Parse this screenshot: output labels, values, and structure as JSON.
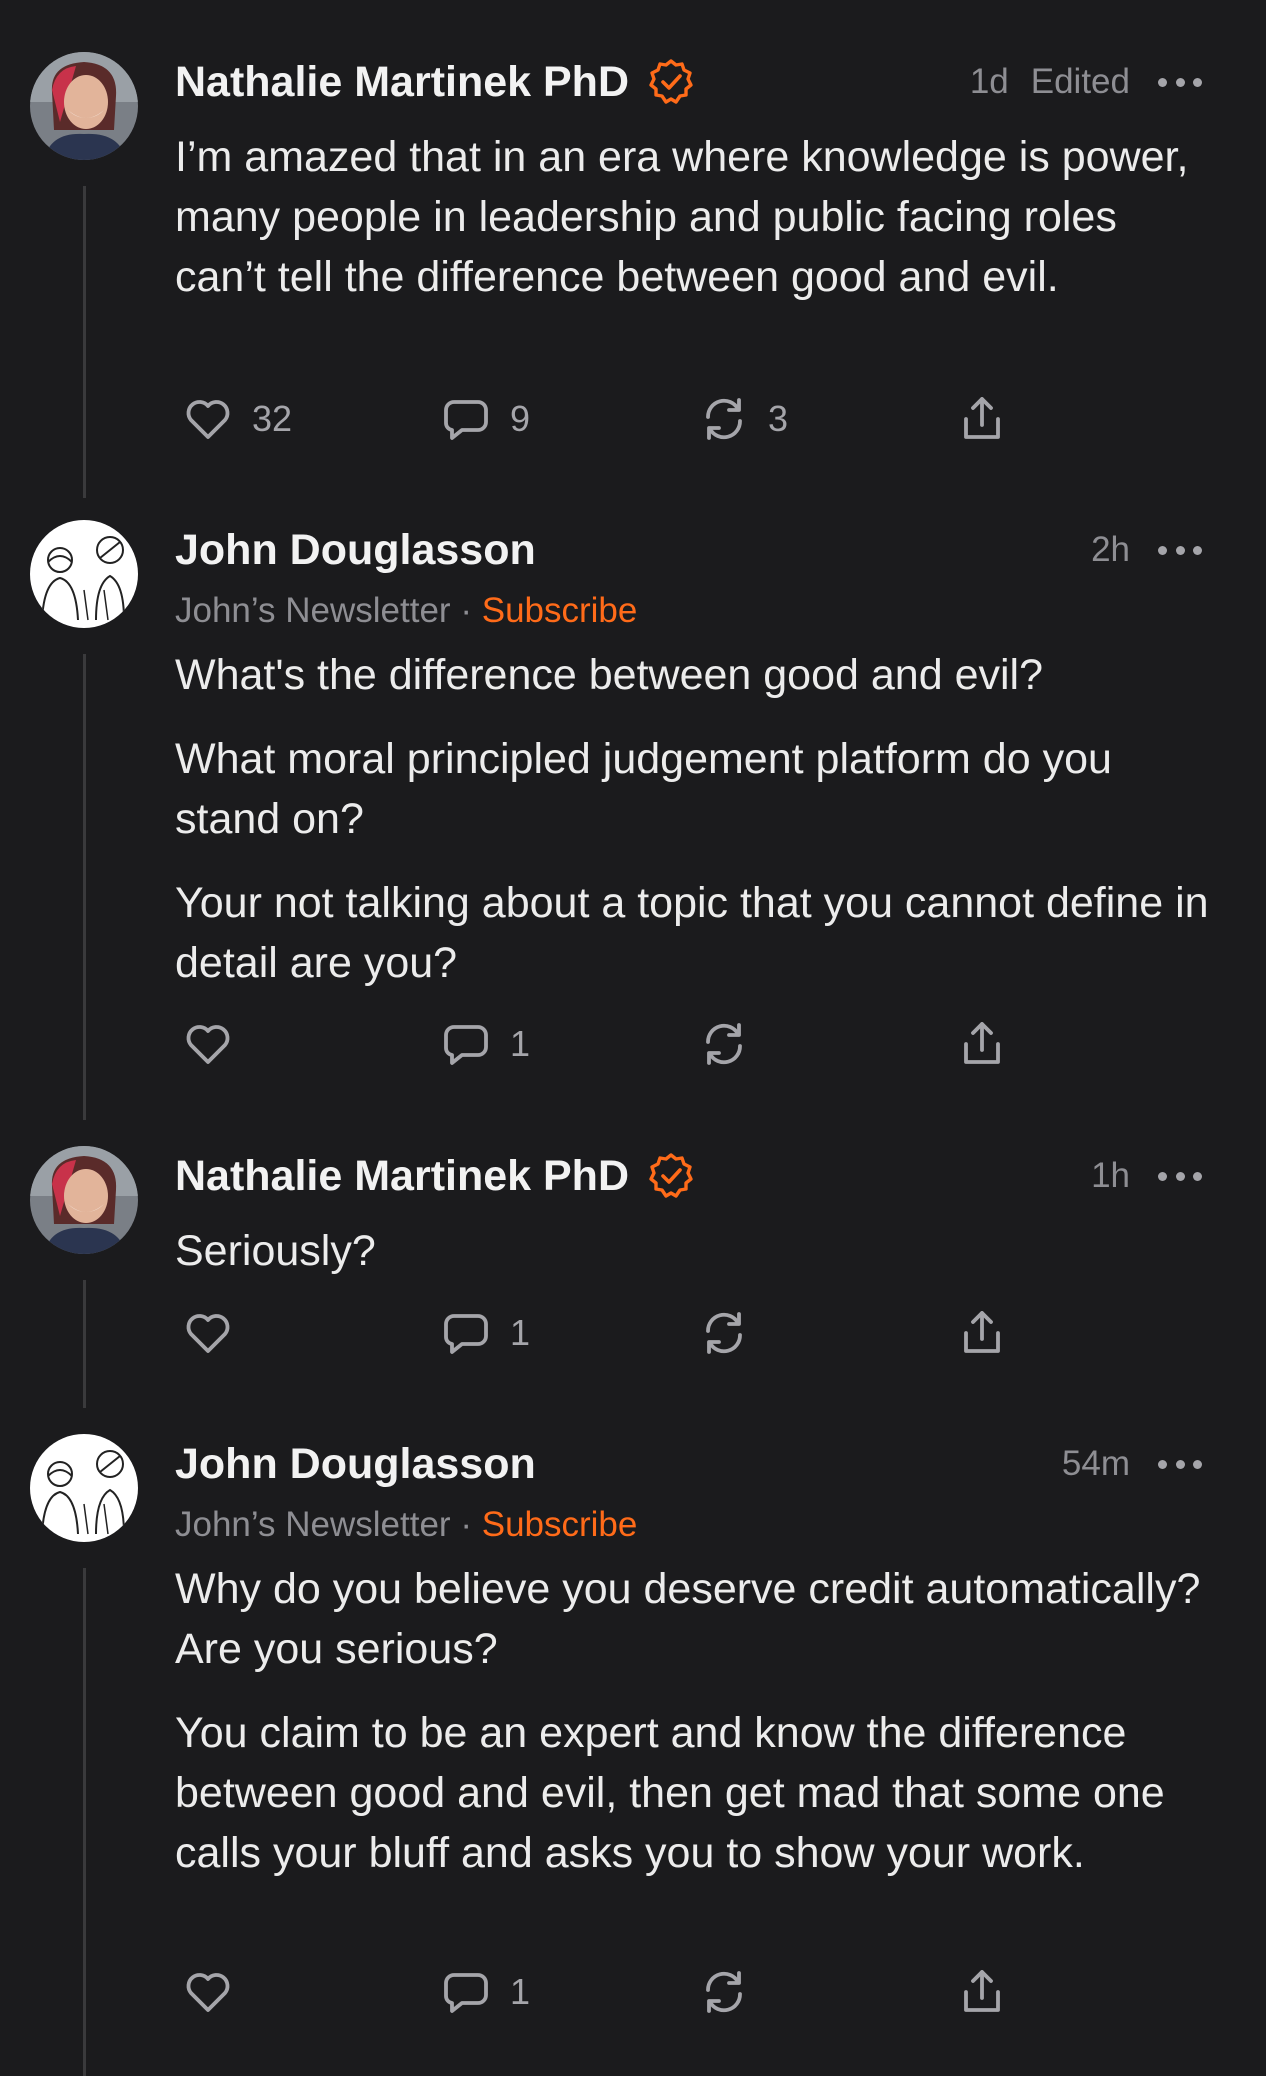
{
  "comments": [
    {
      "author": "Nathalie Martinek PhD",
      "verified": true,
      "time": "1d",
      "edited": "Edited",
      "body": [
        "I’m amazed that in an era where knowledge is power, many people in leadership and public facing roles can’t tell the difference between good and evil."
      ],
      "likes": "32",
      "replies": "9",
      "restacks": "3"
    },
    {
      "author": "John Douglasson",
      "verified": false,
      "time": "2h",
      "publication": "John’s Newsletter",
      "separator": "·",
      "subscribe": "Subscribe",
      "body": [
        "What's the difference between good and evil?",
        "What moral principled judgement platform do you stand on?",
        "Your not talking about a topic that you cannot define in detail are you?"
      ],
      "likes": "",
      "replies": "1",
      "restacks": ""
    },
    {
      "author": "Nathalie Martinek PhD",
      "verified": true,
      "time": "1h",
      "body": [
        "Seriously?"
      ],
      "likes": "",
      "replies": "1",
      "restacks": ""
    },
    {
      "author": "John Douglasson",
      "verified": false,
      "time": "54m",
      "publication": "John’s Newsletter",
      "separator": "·",
      "subscribe": "Subscribe",
      "body": [
        "Why do you believe you deserve credit automatically? Are you serious?",
        "You claim to be an expert and know the difference between good and evil, then get mad that some one calls your bluff and asks you to show your work."
      ],
      "likes": "",
      "replies": "1",
      "restacks": ""
    }
  ],
  "icons": {
    "like": "heart-icon",
    "reply": "comment-bubble-icon",
    "restack": "restack-arrows-icon",
    "share": "share-upload-icon",
    "verified": "verified-check-icon",
    "more": "more-dots-icon"
  },
  "colors": {
    "background": "#1b1b1d",
    "accent": "#ff6b19",
    "muted": "#8e8e93",
    "text": "#ececec"
  }
}
